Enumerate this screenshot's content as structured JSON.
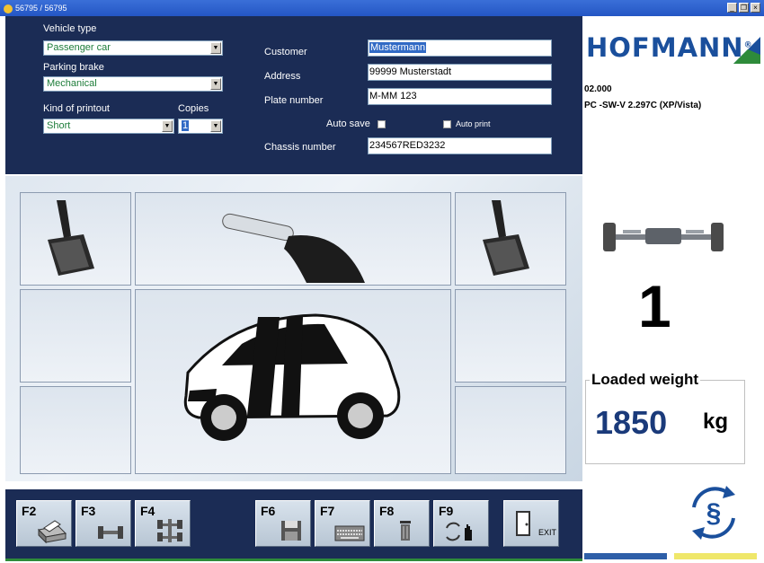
{
  "window": {
    "title": "56795 / 56795"
  },
  "form": {
    "vehicle_type_label": "Vehicle type",
    "vehicle_type_value": "Passenger car",
    "parking_brake_label": "Parking brake",
    "parking_brake_value": "Mechanical",
    "printout_label": "Kind of printout",
    "printout_value": "Short",
    "copies_label": "Copies",
    "copies_value": "1",
    "customer_label": "Customer",
    "customer_value": "Mustermann",
    "address_label": "Address",
    "address_value": "99999 Musterstadt",
    "plate_label": "Plate number",
    "plate_value": "M-MM 123",
    "auto_save_label": "Auto save",
    "auto_print_label": "Auto print",
    "chassis_label": "Chassis number",
    "chassis_value": "234567RED3232"
  },
  "info": {
    "brand": "HOFMANN",
    "brand_mark": "®",
    "version_code": "02.000",
    "software": "PC -SW-V 2.297C (XP/Vista)",
    "axle_number": "1",
    "loaded_weight_label": "Loaded weight",
    "weight_value": "1850",
    "weight_unit": "kg"
  },
  "fkeys": {
    "f2": "F2",
    "f3": "F3",
    "f4": "F4",
    "f6": "F6",
    "f7": "F7",
    "f8": "F8",
    "f9": "F9",
    "exit": "EXIT"
  },
  "colors": {
    "panel": "#1b2c55",
    "brand_blue": "#1a4f9c",
    "brand_green": "#2e8b3a",
    "bar_blue": "#2e5fa8",
    "bar_yellow": "#efe76a"
  }
}
